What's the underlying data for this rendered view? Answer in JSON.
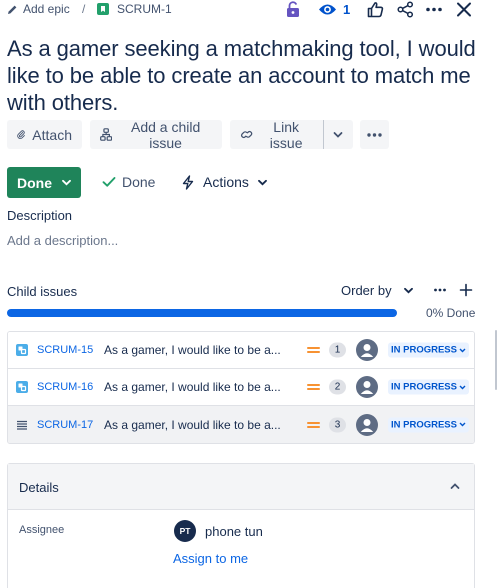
{
  "header": {
    "add_epic_label": "Add epic",
    "separator": "/",
    "parent_key": "SCRUM-1",
    "watch_count": "1"
  },
  "issue": {
    "title": "As a gamer seeking a matchmaking tool, I would like to be able to create an account to match me with others."
  },
  "toolbar": {
    "attach_label": "Attach",
    "add_child_label": "Add a child issue",
    "link_issue_label": "Link issue"
  },
  "status_bar": {
    "status_label": "Done",
    "resolution_label": "Done",
    "actions_label": "Actions"
  },
  "description": {
    "heading": "Description",
    "placeholder": "Add a description..."
  },
  "child_issues": {
    "heading": "Child issues",
    "order_by_label": "Order by",
    "progress_percent": 0,
    "progress_label": "0% Done",
    "items": [
      {
        "key": "SCRUM-15",
        "summary": "As a gamer, I would like to be a...",
        "estimate": "1",
        "status": "IN PROGRESS",
        "type_icon": "subtask-icon"
      },
      {
        "key": "SCRUM-16",
        "summary": "As a gamer, I would like to be a...",
        "estimate": "2",
        "status": "IN PROGRESS",
        "type_icon": "subtask-icon"
      },
      {
        "key": "SCRUM-17",
        "summary": "As a gamer, I would like to be a...",
        "estimate": "3",
        "status": "IN PROGRESS",
        "type_icon": "drag-handle-icon"
      }
    ]
  },
  "details": {
    "heading": "Details",
    "assignee_label": "Assignee",
    "assignee_initials": "PT",
    "assignee_name": "phone tun",
    "assign_to_me_label": "Assign to me"
  },
  "colors": {
    "primary": "#0c66e4",
    "done_green": "#1f845a",
    "priority_orange": "#f79232",
    "text": "#172b4d"
  }
}
